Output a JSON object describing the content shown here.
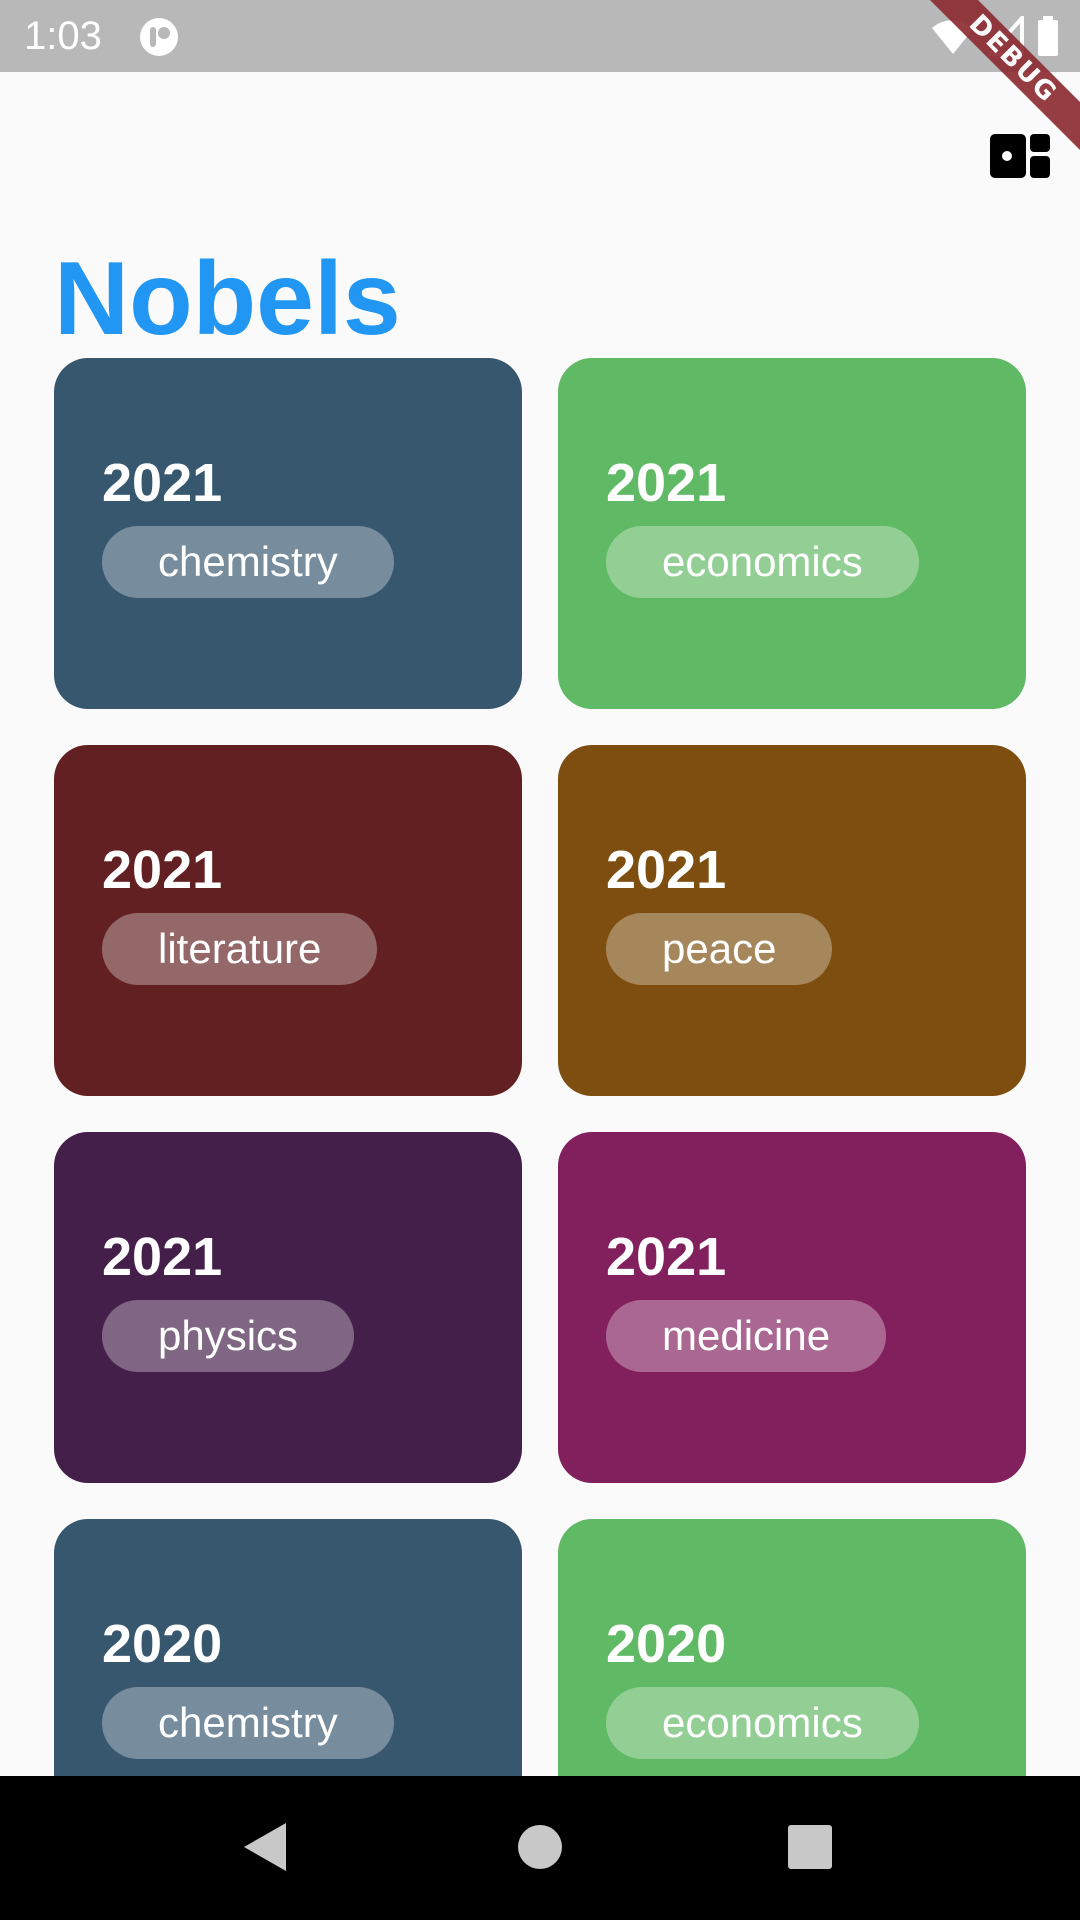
{
  "status_bar": {
    "time": "1:03",
    "icons": [
      "app-notification-icon",
      "wifi-icon",
      "signal-icon",
      "battery-icon"
    ]
  },
  "debug_banner": "DEBUG",
  "toolbar": {
    "action_icon": "dashboard-icon"
  },
  "title": "Nobels",
  "colors": {
    "title": "#2196f3",
    "chemistry": "#37576f",
    "economics": "#60b964",
    "literature": "#622023",
    "peace": "#7d4e0f",
    "physics": "#431f49",
    "medicine": "#82205d"
  },
  "cards": [
    {
      "year": "2021",
      "category": "chemistry"
    },
    {
      "year": "2021",
      "category": "economics"
    },
    {
      "year": "2021",
      "category": "literature"
    },
    {
      "year": "2021",
      "category": "peace"
    },
    {
      "year": "2021",
      "category": "physics"
    },
    {
      "year": "2021",
      "category": "medicine"
    },
    {
      "year": "2020",
      "category": "chemistry"
    },
    {
      "year": "2020",
      "category": "economics"
    }
  ],
  "nav_bar": {
    "buttons": [
      "back-icon",
      "home-icon",
      "recents-icon"
    ]
  }
}
